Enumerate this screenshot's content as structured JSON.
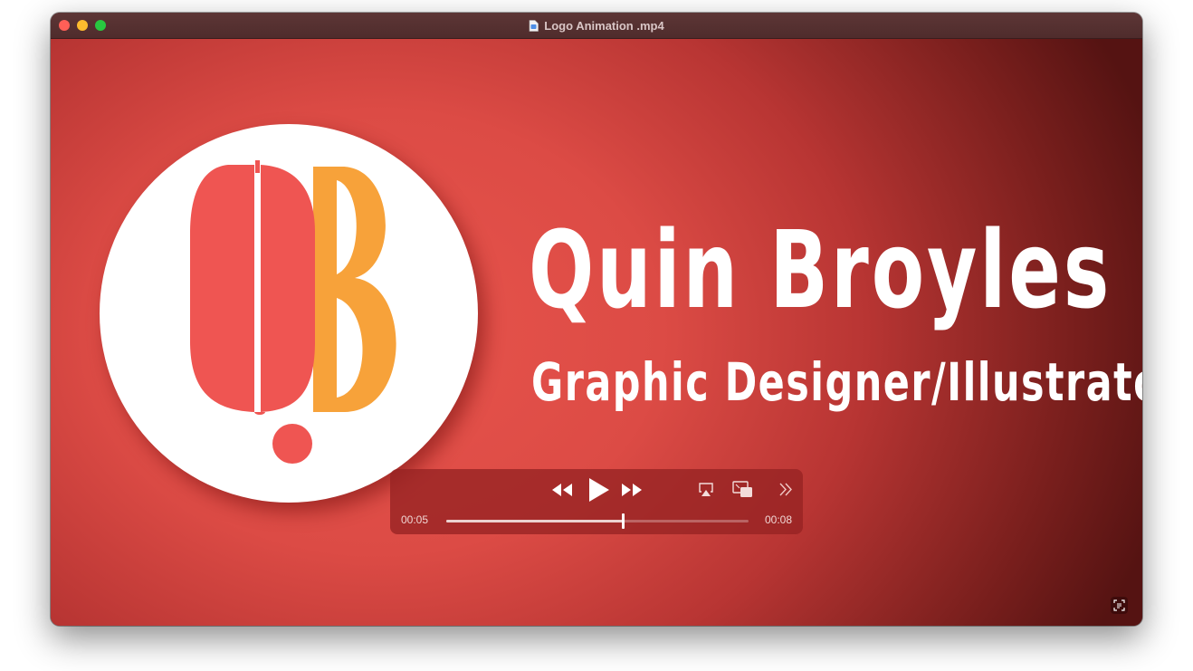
{
  "window": {
    "title": "Logo Animation .mp4"
  },
  "video": {
    "brand_name": "Quin Broyles",
    "brand_role": "Graphic Designer/Illustrator",
    "logo_mark": "QB"
  },
  "player": {
    "current_time": "00:05",
    "duration": "00:08",
    "progress": 0.585
  },
  "icons": {
    "rewind": "rewind-icon",
    "play": "play-icon",
    "fast_forward": "fast-forward-icon",
    "airplay": "airplay-icon",
    "pip": "picture-in-picture-icon",
    "more": "more-controls-icon",
    "live_text": "live-text-icon"
  },
  "colors": {
    "logo_red": "#ef5552",
    "logo_orange": "#f7a23a",
    "background_red": "#dc4b45"
  }
}
